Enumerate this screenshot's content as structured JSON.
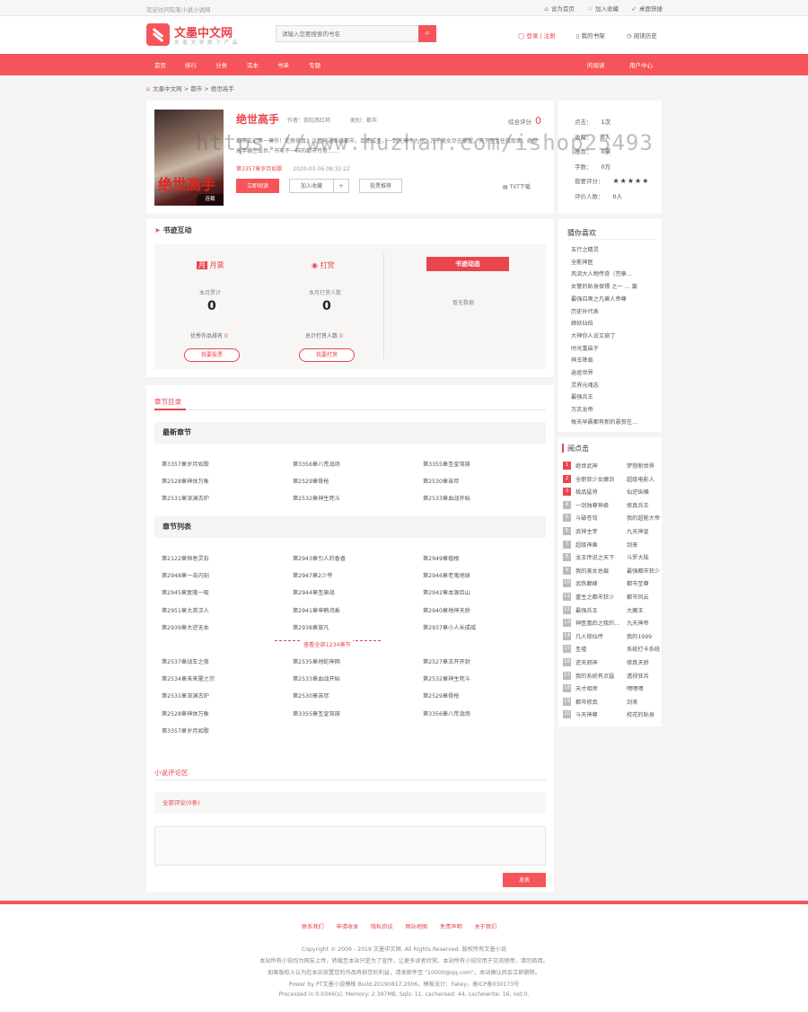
{
  "topbar": {
    "welcome": "欢迎访问铅笔小说小说网",
    "links": [
      "设为首页",
      "加入收藏",
      "桌面快捷"
    ]
  },
  "header": {
    "logo_title": "文墨中文网",
    "logo_sub": "文 墨 文 学 旗 下 产 品",
    "search_placeholder": "请输入您要搜索的书名",
    "login": "登录 | 注册",
    "shelf": "我的书架",
    "history": "阅读历史"
  },
  "nav": {
    "items": [
      "首页",
      "排行",
      "分类",
      "完本",
      "书单",
      "专题"
    ],
    "right": [
      "的阅读",
      "用户中心"
    ]
  },
  "breadcrumb": {
    "home": "文墨中文网",
    "cat": "都市",
    "book": "绝世高手"
  },
  "book": {
    "title": "绝世高手",
    "author": "作者：我吃西红柿",
    "category": "类别：都市",
    "score_label": "综合评分",
    "score": "0",
    "cover_title": "绝世高手",
    "cover_badge": "连载",
    "latest": "第3357章岁月如歌",
    "latest_time": "2020-03-06 08:32:22",
    "btn_read": "立即阅读",
    "btn_shelf": "加入收藏",
    "btn_plus": "+",
    "btn_rec": "投票推荐",
    "txt": "TXT下载",
    "intro": "都市玄幻第一神作！宅男修真，法宝神通纵横都市。百炼成圣，一剑光寒十九州，万千美女尽在掌握，天下至宝任我取舍，绝世高手横空出世，书写不一样的都市传奇……"
  },
  "stats": [
    {
      "label": "点击：",
      "value": "1次"
    },
    {
      "label": "收藏：",
      "value": "0人"
    },
    {
      "label": "推荐：",
      "value": "0票"
    },
    {
      "label": "字数：",
      "value": "0万"
    },
    {
      "label": "我要评分：",
      "value": "★★★★★"
    },
    {
      "label": "评价人数：",
      "value": "0人"
    }
  ],
  "interact": {
    "title": "书迹互动",
    "month_ticket": "月票",
    "reward": "打赏",
    "month_label": "本月票计",
    "month_value": "0",
    "reward_label": "本月打赏人数",
    "reward_value": "0",
    "rank_label": "优秀作品排名",
    "rank_value": "0",
    "total_label": "总计打赏人数",
    "total_value": "0",
    "btn_vote": "我要投票",
    "btn_reward": "我要打赏",
    "dynamic": "书迹动态",
    "no_data": "暂无数据"
  },
  "chapters": {
    "title": "章节目录",
    "latest_head": "最新章节",
    "list_head": "章节列表",
    "view_all": "查看全部1234章节",
    "latest": [
      [
        "第3357章岁月如歌",
        "第3356章八荒战场",
        "第3355章圣皇驾崩"
      ],
      [
        "第2528章神体万象",
        "第2529章骨枪",
        "第2530章苦尽"
      ],
      [
        "第2531章深渊古炉",
        "第2532章神生死斗",
        "第2533章血战开始"
      ]
    ],
    "list1": [
      [
        "第2122章恒者灵石",
        "第2943章引人的香香",
        "第2949章植根"
      ],
      [
        "第2948章一击闪刻",
        "第2947章2少爷",
        "第2946章老鬼地球"
      ],
      [
        "第2945章复隆一吸",
        "第2944章圣旗战",
        "第2942章本源巨山"
      ],
      [
        "第2951章大英汉人",
        "第2941章申鹤鸿乘",
        "第2940章地神天骄"
      ],
      [
        "第2939章大逆无本",
        "第2938章旅凡",
        "第2937章小人长成威"
      ]
    ],
    "list2": [
      [
        "第2537章战车之夜",
        "第2535章地蛇神网",
        "第2527章王开开封"
      ],
      [
        "第2534章未来屠之宗",
        "第2533章血战开始",
        "第2532章神生死斗"
      ],
      [
        "第2531章深渊古炉",
        "第2530章苦尽",
        "第2529章骨枪"
      ],
      [
        "第2528章神体万象",
        "第3355章圣皇驾崩",
        "第3356章八荒战场"
      ],
      [
        "第3357章岁月如歌",
        "",
        ""
      ]
    ]
  },
  "comments": {
    "title": "小说评论区",
    "all": "全部评论(0条)",
    "submit": "发表"
  },
  "side": {
    "likes_title": "猜你喜欢",
    "likes": [
      "五行之精灵",
      "全能神医",
      "风流大人物传奇（完章…",
      "女警的贴身保镖 之一 … 篇",
      "最强召唤之凡兽人帝尊",
      "历史补代表",
      "嫁妖仙伯",
      "大神你人设又崩了",
      "时光重启于",
      "神王降临",
      "逍遥世界",
      "灵界元魂志",
      "最强兵王",
      "万古龙帝",
      "每天早晨都有新的悬赏在…"
    ],
    "hot_title": "阅点击",
    "hot": [
      [
        "绝世武神",
        "梦想新世界"
      ],
      [
        "全职狂少女魔剑",
        "超级电影人"
      ],
      [
        "极品猛将",
        "仙逆纵横"
      ],
      [
        "一剑独尊神君",
        "修真兵王"
      ],
      [
        "斗破苍穹",
        "我的超能大帝"
      ],
      [
        "武神主宰",
        "九天神皇"
      ],
      [
        "超级神兽",
        "剑来"
      ],
      [
        "龙王传说之天下",
        "斗罗大陆"
      ],
      [
        "我的美女总裁",
        "最强都市狂少"
      ],
      [
        "武炼巅峰",
        "都市至尊"
      ],
      [
        "重生之都市狂少",
        "都市风云"
      ],
      [
        "最强兵王",
        "大魔王"
      ],
      [
        "神医凰后之我的…",
        "九天神帝"
      ],
      [
        "凡人修仙传",
        "我的1999"
      ],
      [
        "圣墟",
        "系统打卡系统"
      ],
      [
        "逆天邪神",
        "修真天骄"
      ],
      [
        "我的系统有点猛",
        "透视狂兵"
      ],
      [
        "天才相师",
        "嘿嘿嘿"
      ],
      [
        "都市修真",
        "剑来"
      ],
      [
        "斗天神尊",
        "校花的贴身"
      ]
    ]
  },
  "footer": {
    "links": [
      "联系我们",
      "申请收录",
      "隐私协议",
      "网站地图",
      "免责声明",
      "关于我们"
    ],
    "copyright": "Copyright © 2009 - 2019 文墨中文网. All Rights Reserved. 版权所有文墨小说",
    "l2": "本站所有小说均为网友上传，转载至本站只是为了宣传，让更多读者欣赏。本站所有小说仅用于交流使用，请勿商用。",
    "l3": "如果版权人认为在本站放置您的作品有损您的利益，请发邮件至 \"10000@qq.com\"，本站确认后会立即删除。",
    "power": "Power by PT文墨小说模板 Build.20190817.2006，模板设计：Fakey，备ICP备030173号",
    "process": "Processed in 0.0346(s), Memory: 2.397MB, Sqls: 11, cacheread: 44, cachewrite: 16, net:0."
  },
  "watermark": "https://www.huzhan.com/ishop25493",
  "colors": {
    "accent": "#f6545a",
    "brand": "#e8454c"
  }
}
